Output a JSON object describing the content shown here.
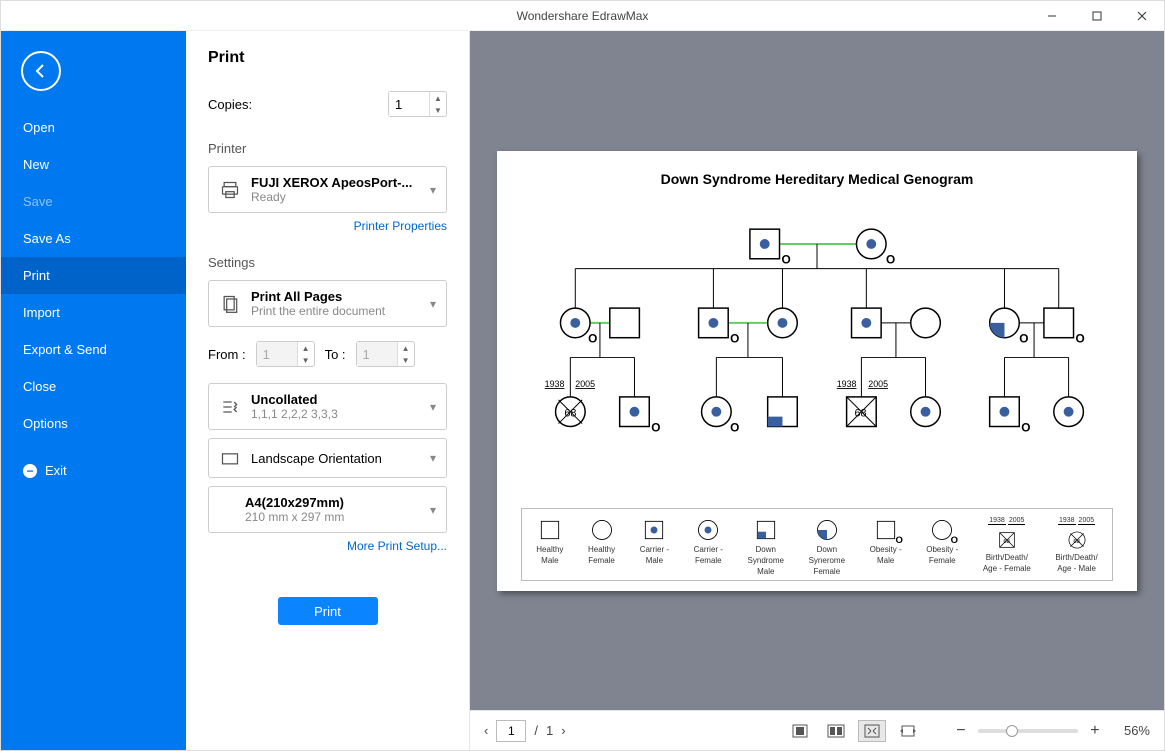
{
  "app_title": "Wondershare EdrawMax",
  "sidebar": {
    "items": [
      {
        "label": "Open",
        "active": false
      },
      {
        "label": "New",
        "active": false
      },
      {
        "label": "Save",
        "active": false,
        "muted": true
      },
      {
        "label": "Save As",
        "active": false
      },
      {
        "label": "Print",
        "active": true
      },
      {
        "label": "Import",
        "active": false
      },
      {
        "label": "Export & Send",
        "active": false
      },
      {
        "label": "Close",
        "active": false
      },
      {
        "label": "Options",
        "active": false
      }
    ],
    "exit_label": "Exit"
  },
  "panel": {
    "title": "Print",
    "copies_label": "Copies:",
    "copies_value": "1",
    "printer_section": "Printer",
    "printer_name": "FUJI XEROX ApeosPort-...",
    "printer_status": "Ready",
    "printer_properties": "Printer Properties",
    "settings_section": "Settings",
    "pages_title": "Print All Pages",
    "pages_sub": "Print the entire document",
    "from_label": "From :",
    "from_value": "1",
    "to_label": "To :",
    "to_value": "1",
    "collate_title": "Uncollated",
    "collate_sub": "1,1,1   2,2,2   3,3,3",
    "orientation": "Landscape Orientation",
    "paper_title": "A4(210x297mm)",
    "paper_sub": "210 mm x 297 mm",
    "more_setup": "More Print Setup...",
    "print_button": "Print"
  },
  "preview": {
    "doc_title": "Down Syndrome Hereditary Medical Genogram",
    "years": {
      "a": "1938",
      "b": "2005"
    },
    "age_label": "68",
    "legend": [
      {
        "label1": "Healthy",
        "label2": "Male"
      },
      {
        "label1": "Healthy",
        "label2": "Female"
      },
      {
        "label1": "Carrier -",
        "label2": "Male"
      },
      {
        "label1": "Carrier -",
        "label2": "Female"
      },
      {
        "label1": "Down",
        "label2": "Syndrome",
        "label3": "Male"
      },
      {
        "label1": "Down",
        "label2": "Synerome",
        "label3": "Female"
      },
      {
        "label1": "Obesity -",
        "label2": "Male"
      },
      {
        "label1": "Obesity -",
        "label2": "Female"
      },
      {
        "label1": "Birth/Death/",
        "label2": "Age - Female"
      },
      {
        "label1": "Birth/Death/",
        "label2": "Age - Male"
      }
    ]
  },
  "footer": {
    "page_value": "1",
    "page_total": "1",
    "zoom_pct": "56%"
  }
}
